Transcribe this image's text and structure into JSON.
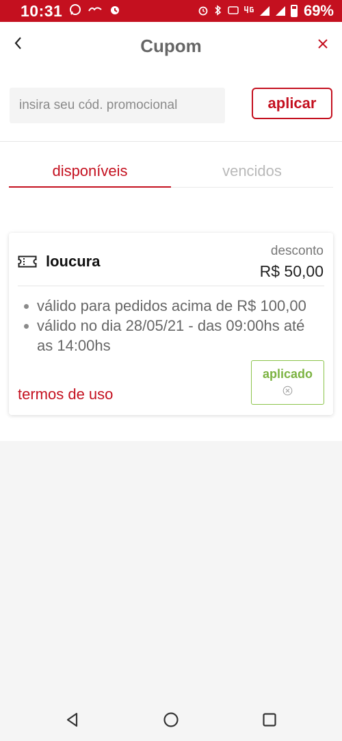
{
  "status_bar": {
    "time": "10:31",
    "battery_percent": "69%",
    "left_icons": [
      "whatsapp-icon",
      "ifood-icon",
      "sync-icon"
    ],
    "right_icons": [
      "alarm-icon",
      "bluetooth-icon",
      "volte-icon",
      "4g-icon",
      "signal-icon",
      "signal-icon",
      "battery-icon"
    ]
  },
  "header": {
    "title": "Cupom"
  },
  "promo": {
    "placeholder": "insira seu cód. promocional",
    "value": "",
    "apply_label": "aplicar"
  },
  "tabs": [
    {
      "label": "disponíveis",
      "active": true
    },
    {
      "label": "vencidos",
      "active": false
    }
  ],
  "coupon": {
    "name": "loucura",
    "discount_label": "desconto",
    "discount_value": "R$ 50,00",
    "rules": [
      "válido para pedidos acima de R$ 100,00",
      "válido no dia 28/05/21 - das 09:00hs até as 14:00hs"
    ],
    "terms_label": "termos de uso",
    "applied_label": "aplicado"
  },
  "colors": {
    "brand": "#c4101f",
    "applied": "#7cb342",
    "muted_text": "#666666",
    "inactive_tab": "#b9b9b9"
  }
}
